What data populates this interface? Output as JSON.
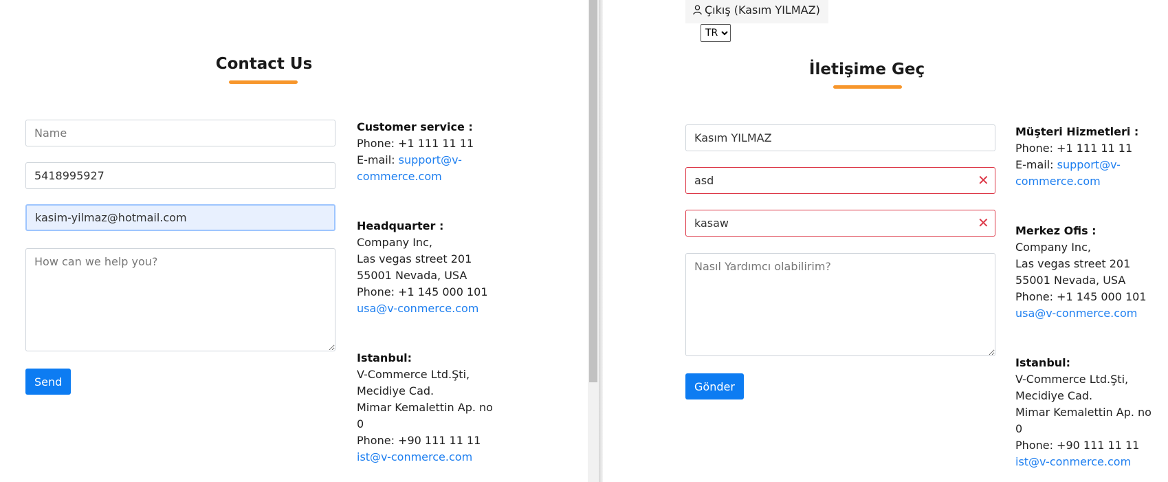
{
  "left": {
    "title": "Contact Us",
    "form": {
      "name_placeholder": "Name",
      "name_value": "",
      "phone_value": "5418995927",
      "email_value": "kasim-yilmaz@hotmail.com",
      "message_placeholder": "How can we help you?",
      "send_label": "Send"
    },
    "info": {
      "customer_service_label": "Customer service :",
      "phone": "Phone: +1 111 11 11",
      "email_prefix": "E-mail: ",
      "email_link_1": "support@v-",
      "email_link_2": "commerce.com",
      "hq_label": "Headquarter :",
      "hq_line1": "Company Inc,",
      "hq_line2": "Las vegas street 201",
      "hq_line3": "55001 Nevada, USA",
      "hq_phone": "Phone: +1 145 000 101",
      "hq_email": "usa@v-conmerce.com",
      "ist_label": "Istanbul:",
      "ist_line1": "V-Commerce Ltd.Şti,",
      "ist_line2": "Mecidiye Cad.",
      "ist_line3": "Mimar Kemalettin Ap. no",
      "ist_line4": "0",
      "ist_phone": "Phone: +90 111 11 11",
      "ist_email": "ist@v-conmerce.com"
    }
  },
  "right": {
    "logout_label": "Çıkış (Kasım YILMAZ)",
    "language_selected": "TR",
    "title": "İletişime Geç",
    "form": {
      "name_value": "Kasım YILMAZ",
      "phone_value": "asd",
      "email_value": "kasaw",
      "message_placeholder": "Nasıl Yardımcı olabilirim?",
      "send_label": "Gönder",
      "error_icon": "✕"
    },
    "info": {
      "customer_service_label": "Müşteri Hizmetleri :",
      "phone": "Phone: +1 111 11 11",
      "email_prefix": "E-mail: ",
      "email_link_1": "support@v-",
      "email_link_2": "commerce.com",
      "hq_label": "Merkez Ofis :",
      "hq_line1": "Company Inc,",
      "hq_line2": "Las vegas street 201",
      "hq_line3": "55001 Nevada, USA",
      "hq_phone": "Phone: +1 145 000 101",
      "hq_email": "usa@v-conmerce.com",
      "ist_label": "Istanbul:",
      "ist_line1": "V-Commerce Ltd.Şti,",
      "ist_line2": "Mecidiye Cad.",
      "ist_line3": "Mimar Kemalettin Ap. no",
      "ist_line4": "0",
      "ist_phone": "Phone: +90 111 11 11",
      "ist_email": "ist@v-conmerce.com"
    }
  },
  "colors": {
    "accent_underline": "#f7962b",
    "button_blue": "#0d7cf2",
    "link_blue": "#1e7ff0",
    "error_red": "#dc3545"
  }
}
